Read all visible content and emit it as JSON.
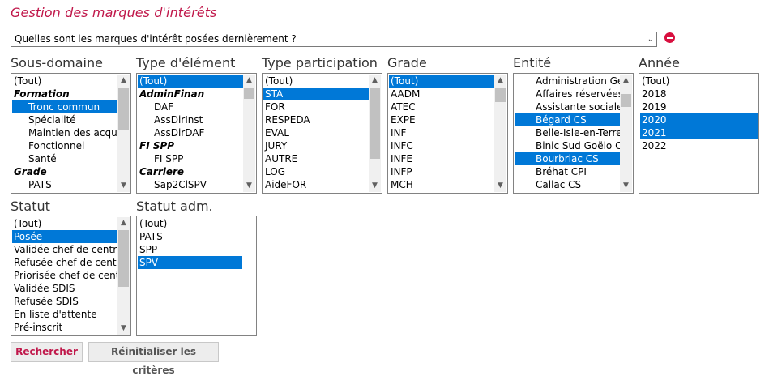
{
  "page": {
    "title": "Gestion des marques d'intérêts"
  },
  "query": {
    "value": "Quelles sont les marques d'intérêt posées dernièrement ?"
  },
  "filters": {
    "sous_domaine": {
      "label": "Sous-domaine",
      "items": [
        {
          "text": "(Tout)",
          "kind": "plain",
          "selected": false
        },
        {
          "text": "Formation",
          "kind": "group",
          "selected": false
        },
        {
          "text": "Tronc commun",
          "kind": "sub",
          "selected": true
        },
        {
          "text": "Spécialité",
          "kind": "sub",
          "selected": false
        },
        {
          "text": "Maintien des acquis",
          "kind": "sub",
          "selected": false
        },
        {
          "text": "Fonctionnel",
          "kind": "sub",
          "selected": false
        },
        {
          "text": "Santé",
          "kind": "sub",
          "selected": false
        },
        {
          "text": "Grade",
          "kind": "group",
          "selected": false
        },
        {
          "text": "PATS",
          "kind": "sub",
          "selected": false
        }
      ]
    },
    "type_element": {
      "label": "Type d'élément",
      "items": [
        {
          "text": "(Tout)",
          "kind": "plain",
          "selected": true
        },
        {
          "text": "AdminFinan",
          "kind": "group",
          "selected": false
        },
        {
          "text": "DAF",
          "kind": "sub",
          "selected": false
        },
        {
          "text": "AssDirInst",
          "kind": "sub",
          "selected": false
        },
        {
          "text": "AssDirDAF",
          "kind": "sub",
          "selected": false
        },
        {
          "text": "FI SPP",
          "kind": "group",
          "selected": false
        },
        {
          "text": "FI SPP",
          "kind": "sub",
          "selected": false
        },
        {
          "text": "Carriere",
          "kind": "group",
          "selected": false
        },
        {
          "text": "Sap2ClSPV",
          "kind": "sub",
          "selected": false
        }
      ]
    },
    "type_participation": {
      "label": "Type participation",
      "items": [
        {
          "text": "(Tout)",
          "kind": "plain",
          "selected": false
        },
        {
          "text": "STA",
          "kind": "plain",
          "selected": true
        },
        {
          "text": "FOR",
          "kind": "plain",
          "selected": false
        },
        {
          "text": "RESPEDA",
          "kind": "plain",
          "selected": false
        },
        {
          "text": "EVAL",
          "kind": "plain",
          "selected": false
        },
        {
          "text": "JURY",
          "kind": "plain",
          "selected": false
        },
        {
          "text": "AUTRE",
          "kind": "plain",
          "selected": false
        },
        {
          "text": "LOG",
          "kind": "plain",
          "selected": false
        },
        {
          "text": "AideFOR",
          "kind": "plain",
          "selected": false
        }
      ]
    },
    "grade": {
      "label": "Grade",
      "items": [
        {
          "text": "(Tout)",
          "kind": "plain",
          "selected": true
        },
        {
          "text": "AADM",
          "kind": "plain",
          "selected": false
        },
        {
          "text": "ATEC",
          "kind": "plain",
          "selected": false
        },
        {
          "text": "EXPE",
          "kind": "plain",
          "selected": false
        },
        {
          "text": "INF",
          "kind": "plain",
          "selected": false
        },
        {
          "text": "INFC",
          "kind": "plain",
          "selected": false
        },
        {
          "text": "INFE",
          "kind": "plain",
          "selected": false
        },
        {
          "text": "INFP",
          "kind": "plain",
          "selected": false
        },
        {
          "text": "MCH",
          "kind": "plain",
          "selected": false
        }
      ]
    },
    "entite": {
      "label": "Entité",
      "items": [
        {
          "text": "Administration Générale",
          "kind": "ind",
          "selected": false
        },
        {
          "text": "Affaires réservées",
          "kind": "ind",
          "selected": false
        },
        {
          "text": "Assistante sociale",
          "kind": "ind",
          "selected": false
        },
        {
          "text": "Bégard CS",
          "kind": "ind",
          "selected": true
        },
        {
          "text": "Belle-Isle-en-Terre",
          "kind": "ind",
          "selected": false
        },
        {
          "text": "Binic Sud Goëlo CS",
          "kind": "ind",
          "selected": false
        },
        {
          "text": "Bourbriac CS",
          "kind": "ind",
          "selected": true
        },
        {
          "text": "Bréhat CPI",
          "kind": "ind",
          "selected": false
        },
        {
          "text": "Callac CS",
          "kind": "ind",
          "selected": false
        }
      ]
    },
    "annee": {
      "label": "Année",
      "items": [
        {
          "text": "(Tout)",
          "kind": "plain",
          "selected": false
        },
        {
          "text": "2018",
          "kind": "plain",
          "selected": false
        },
        {
          "text": "2019",
          "kind": "plain",
          "selected": false
        },
        {
          "text": "2020",
          "kind": "plain",
          "selected": true
        },
        {
          "text": "2021",
          "kind": "plain",
          "selected": true
        },
        {
          "text": "2022",
          "kind": "plain",
          "selected": false
        }
      ]
    },
    "statut": {
      "label": "Statut",
      "items": [
        {
          "text": "(Tout)",
          "kind": "plain",
          "selected": false
        },
        {
          "text": "Posée",
          "kind": "plain",
          "selected": true
        },
        {
          "text": "Validée chef de centre",
          "kind": "plain",
          "selected": false
        },
        {
          "text": "Refusée chef de centre",
          "kind": "plain",
          "selected": false
        },
        {
          "text": "Priorisée chef de centre",
          "kind": "plain",
          "selected": false
        },
        {
          "text": "Validée SDIS",
          "kind": "plain",
          "selected": false
        },
        {
          "text": "Refusée SDIS",
          "kind": "plain",
          "selected": false
        },
        {
          "text": "En liste d'attente",
          "kind": "plain",
          "selected": false
        },
        {
          "text": "Pré-inscrit",
          "kind": "plain",
          "selected": false
        }
      ]
    },
    "statut_adm": {
      "label": "Statut adm.",
      "items": [
        {
          "text": "(Tout)",
          "kind": "plain",
          "selected": false
        },
        {
          "text": "PATS",
          "kind": "plain",
          "selected": false
        },
        {
          "text": "SPP",
          "kind": "plain",
          "selected": false
        },
        {
          "text": "SPV",
          "kind": "plain",
          "selected": true
        }
      ]
    }
  },
  "buttons": {
    "search": "Rechercher",
    "reset": "Réinitialiser les critères"
  },
  "colors": {
    "accent": "#c0174a",
    "selection": "#0078d7",
    "clear": "#d8103f"
  }
}
